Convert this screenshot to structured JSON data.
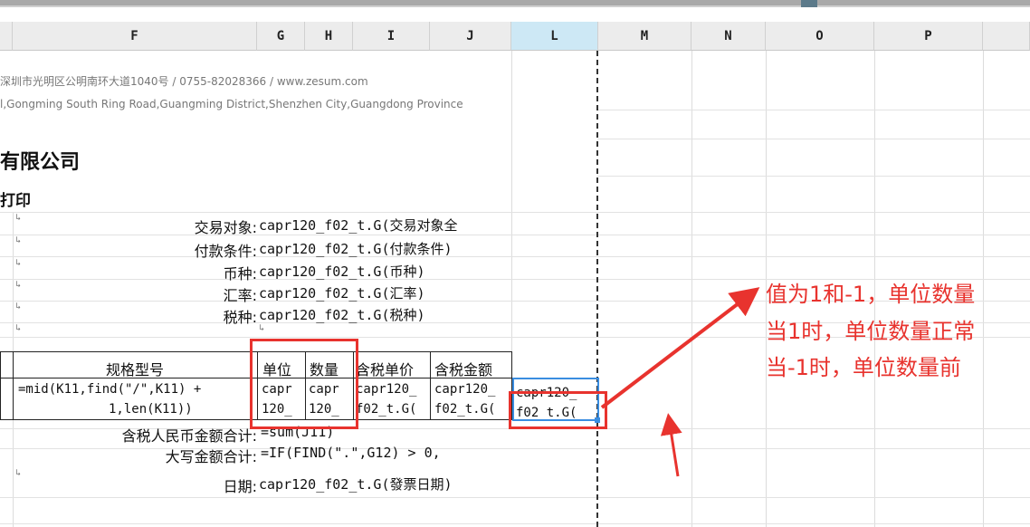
{
  "columns": [
    {
      "label": "F"
    },
    {
      "label": "G"
    },
    {
      "label": "H"
    },
    {
      "label": "I"
    },
    {
      "label": "J"
    },
    {
      "label": "L"
    },
    {
      "label": "M"
    },
    {
      "label": "N"
    },
    {
      "label": "O"
    },
    {
      "label": "P"
    }
  ],
  "sheet": {
    "address_cn": "深圳市光明区公明南环大道1040号  /   0755-82028366  /   www.zesum.com",
    "address_en": "l,Gongming South Ring Road,Guangming District,Shenzhen City,Guangdong Province",
    "company": "有限公司",
    "print_title": "打印",
    "fields": [
      {
        "label": "交易对象:",
        "value": "capr120_f02_t.G(交易对象全"
      },
      {
        "label": "付款条件:",
        "value": "capr120_f02_t.G(付款条件)"
      },
      {
        "label": "币种:",
        "value": "capr120_f02_t.G(币种)"
      },
      {
        "label": "汇率:",
        "value": "capr120_f02_t.G(汇率)"
      },
      {
        "label": "税种:",
        "value": "capr120_f02_t.G(税种)"
      }
    ],
    "table_headers": {
      "spec": "规格型号",
      "unit": "单位",
      "qty": "数量",
      "unit_price": "含税单价",
      "amount": "含税金额"
    },
    "row": {
      "spec_line1": "=mid(K11,find(\"/\",K11) +",
      "spec_line2": "1,len(K11))",
      "unit_line1": "capr",
      "unit_line2": "120_",
      "qty_line1": "capr",
      "qty_line2": "120_",
      "price_line1": "capr120_",
      "price_line2": "f02_t.G(",
      "amount_line1": "capr120_",
      "amount_line2": "f02_t.G(",
      "l_line1": "capr120_",
      "l_line2": "f02_t.G("
    },
    "totals": [
      {
        "label": "含税人民币金额合计:",
        "value": "=sum(J11)"
      },
      {
        "label": "大写金额合计:",
        "value": "=IF(FIND(\".\",G12) > 0,"
      }
    ],
    "date": {
      "label": "日期:",
      "value": "capr120_f02_t.G(發票日期)"
    }
  },
  "annotation": {
    "line1": "值为1和-1，单位数量",
    "line2": "当1时，单位数量正常",
    "line3": "当-1时，单位数量前"
  },
  "colors": {
    "highlight": "#e8332e",
    "selection": "#3a8de0",
    "selected_header": "#cde8f5"
  }
}
